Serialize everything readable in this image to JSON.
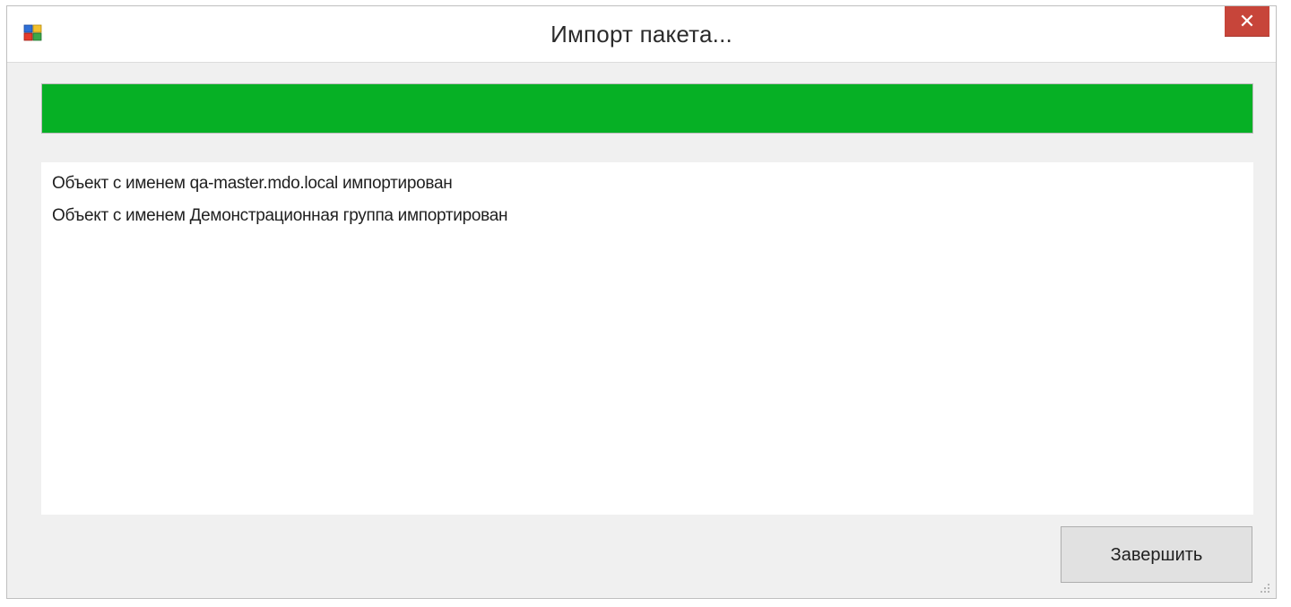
{
  "window": {
    "title": "Импорт пакета...",
    "close_label": "✕",
    "icon": "app-window-icon"
  },
  "progress": {
    "value_percent": 100,
    "color": "#06b025"
  },
  "log": {
    "lines": [
      "Объект с именем qa-master.mdo.local импортирован",
      "Объект с именем Демонстрационная группа импортирован"
    ]
  },
  "buttons": {
    "finish_label": "Завершить"
  },
  "colors": {
    "close_button": "#c7453a",
    "window_bg": "#f0f0f0"
  }
}
